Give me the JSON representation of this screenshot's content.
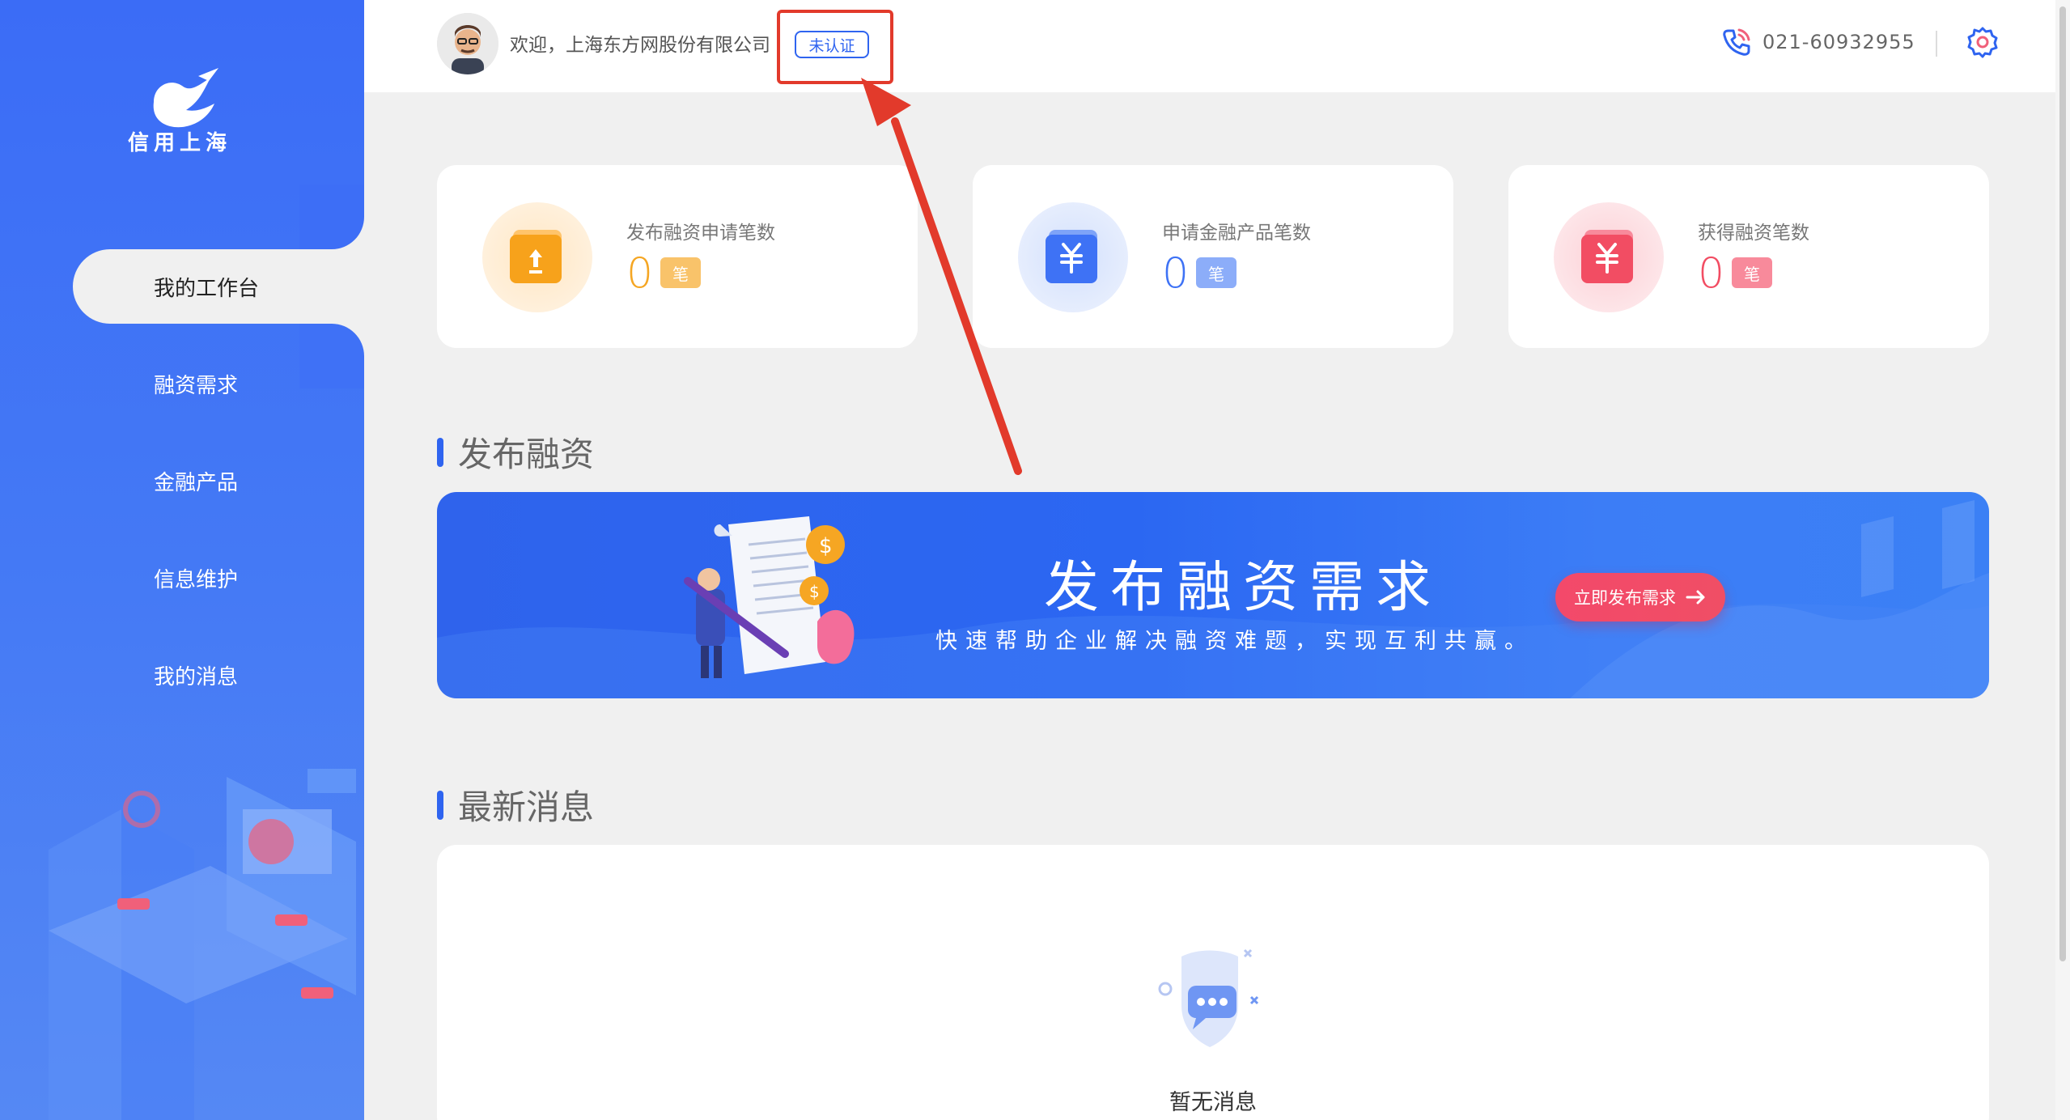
{
  "sidebar": {
    "logo_text": "信用上海",
    "items": [
      {
        "label": "我的工作台",
        "active": true
      },
      {
        "label": "融资需求",
        "active": false
      },
      {
        "label": "金融产品",
        "active": false
      },
      {
        "label": "信息维护",
        "active": false
      },
      {
        "label": "我的消息",
        "active": false
      }
    ]
  },
  "header": {
    "welcome": "欢迎，上海东方网股份有限公司",
    "cert_status": "未认证",
    "phone": "021-60932955"
  },
  "stats": [
    {
      "label": "发布融资申请笔数",
      "value": "0",
      "unit": "笔",
      "color": "#f5a623"
    },
    {
      "label": "申请金融产品笔数",
      "value": "0",
      "unit": "笔",
      "color": "#3e72f5"
    },
    {
      "label": "获得融资笔数",
      "value": "0",
      "unit": "笔",
      "color": "#f24d63"
    }
  ],
  "sections": {
    "publish": "发布融资",
    "messages": "最新消息"
  },
  "banner": {
    "title": "发布融资需求",
    "subtitle": "快速帮助企业解决融资难题，实现互利共赢。",
    "button": "立即发布需求"
  },
  "messages": {
    "empty": "暂无消息"
  },
  "colors": {
    "primary": "#2f64f0",
    "annotation": "#e23a2b"
  }
}
